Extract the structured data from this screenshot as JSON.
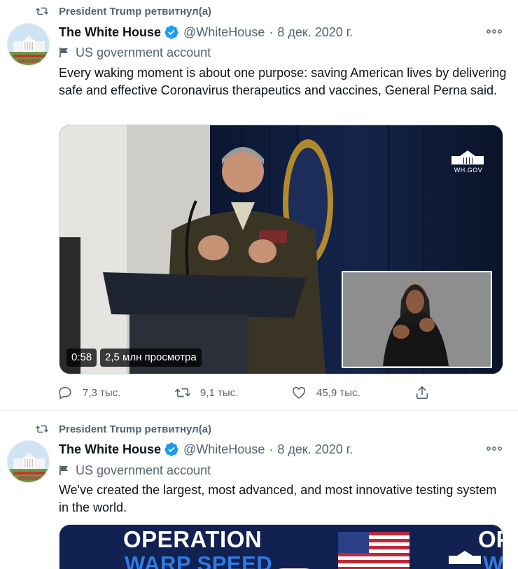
{
  "colors": {
    "secondary": "#536471",
    "verified": "#1d9bf0",
    "divider": "#e6ecf0"
  },
  "tweets": [
    {
      "retweet_label": "President Trump ретвитнул(а)",
      "name": "The White House",
      "handle": "@WhiteHouse",
      "separator": "·",
      "date": "8 дек. 2020 г.",
      "gov_label": "US government account",
      "text": "Every waking moment is about one purpose: saving American lives by delivering safe and effective Coronavirus therapeutics and vaccines, General Perna said.",
      "media": {
        "watermark": "WH.GOV",
        "duration": "0:58",
        "views": "2,5 млн просмотра"
      },
      "actions": {
        "replies": "7,3 тыс.",
        "retweets": "9,1 тыс.",
        "likes": "45,9 тыс."
      }
    },
    {
      "retweet_label": "President Trump ретвитнул(а)",
      "name": "The White House",
      "handle": "@WhiteHouse",
      "separator": "·",
      "date": "8 дек. 2020 г.",
      "gov_label": "US government account",
      "text": "We've created the largest, most advanced, and most innovative testing system in the world.",
      "media": {
        "banner_line1": "OPERATION",
        "banner_line2": "WARP SPEED",
        "right_fragment_1": "OP",
        "right_fragment_2": "W"
      }
    }
  ]
}
